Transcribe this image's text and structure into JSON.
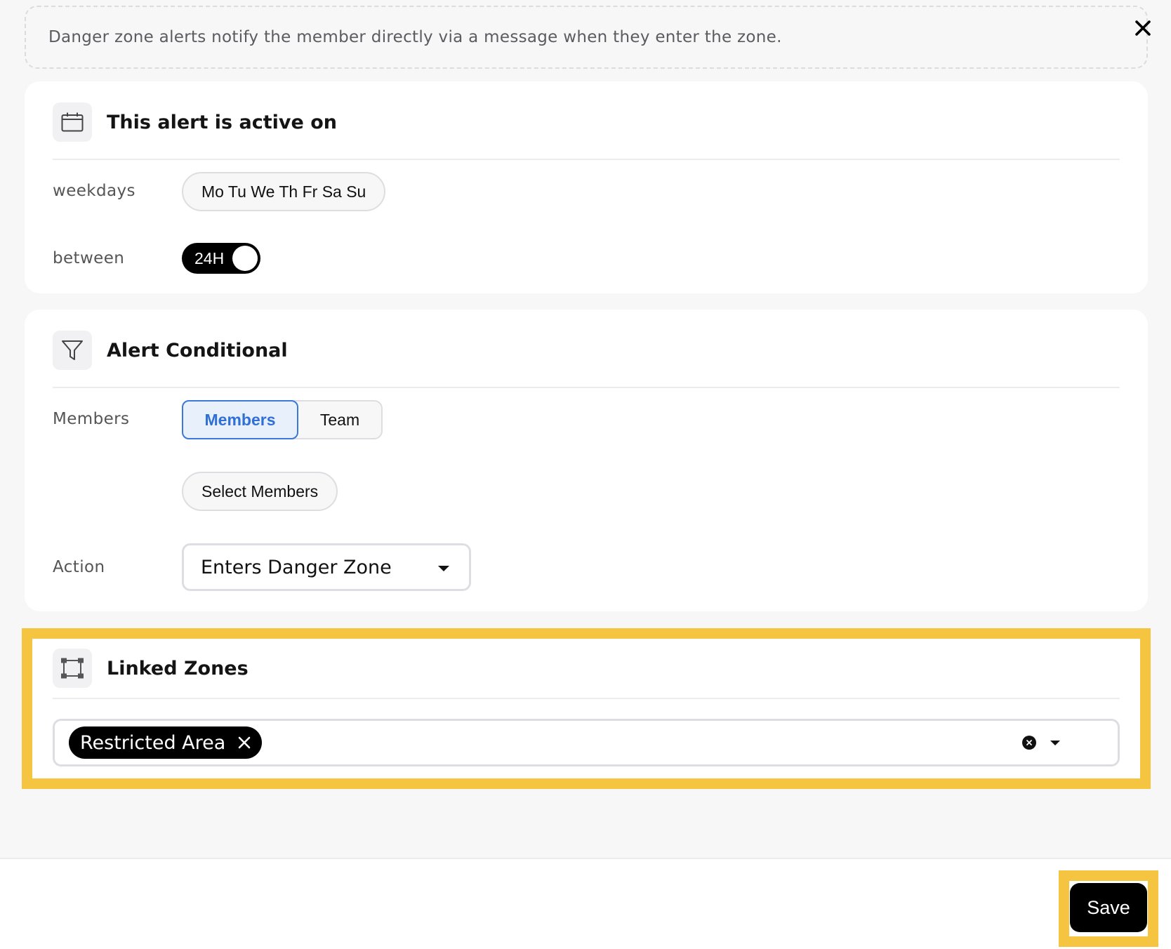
{
  "banner": {
    "text": "Danger zone alerts notify the member directly via a message when they enter the zone.",
    "close_icon": "close-icon"
  },
  "schedule": {
    "title": "This alert is active on",
    "icon": "calendar-icon",
    "weekdays_label": "weekdays",
    "weekdays_value": "Mo Tu We Th Fr Sa Su",
    "between_label": "between",
    "toggle_label": "24H"
  },
  "conditional": {
    "title": "Alert Conditional",
    "icon": "filter-icon",
    "members_label": "Members",
    "segments": [
      {
        "label": "Members",
        "active": true
      },
      {
        "label": "Team",
        "active": false
      }
    ],
    "select_members": "Select Members",
    "action_label": "Action",
    "action_value": "Enters Danger Zone"
  },
  "linked_zones": {
    "title": "Linked Zones",
    "icon": "polygon-zone-icon",
    "selected": [
      "Restricted Area"
    ]
  },
  "footer": {
    "save_label": "Save"
  },
  "colors": {
    "highlight": "#f5c542",
    "accent": "#2f6fd6",
    "panel_bg": "#f7f7f8"
  }
}
